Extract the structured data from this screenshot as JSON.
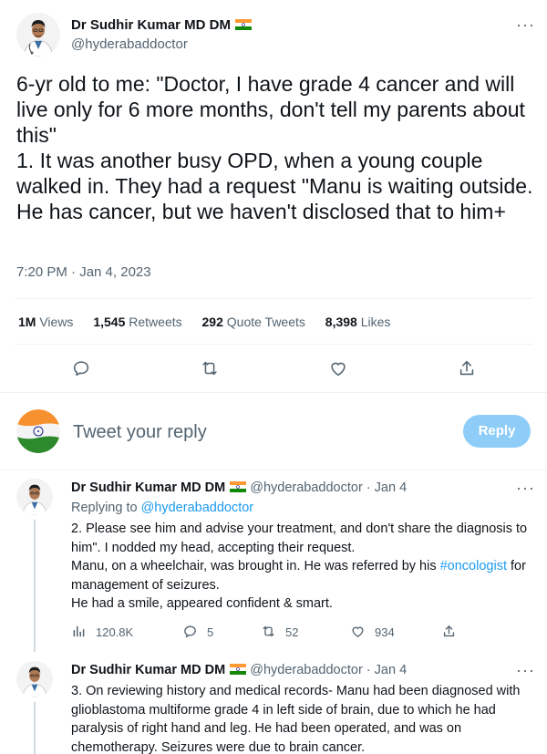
{
  "main_tweet": {
    "author_name": "Dr Sudhir Kumar MD DM",
    "author_handle": "@hyderabaddoctor",
    "text": "6-yr old to me: \"Doctor, I have grade 4 cancer and will live only for 6 more months, don't tell my parents about this\"\n1. It was another busy OPD, when a young couple walked in. They had a request \"Manu is waiting outside. He has cancer, but we haven't disclosed that to him+",
    "timestamp": "7:20 PM · Jan 4, 2023",
    "stats": {
      "views_num": "1M",
      "views_label": "Views",
      "retweets_num": "1,545",
      "retweets_label": "Retweets",
      "quotes_num": "292",
      "quotes_label": "Quote Tweets",
      "likes_num": "8,398",
      "likes_label": "Likes"
    },
    "icons": [
      "reply-icon",
      "retweet-icon",
      "like-icon",
      "share-icon"
    ]
  },
  "reply_box": {
    "placeholder": "Tweet your reply",
    "button_label": "Reply"
  },
  "replies": [
    {
      "author_name": "Dr Sudhir Kumar MD DM",
      "meta": "@hyderabaddoctor · Jan 4",
      "replying_prefix": "Replying to",
      "replying_to": "@hyderabaddoctor",
      "text_1": "2. Please see him and advise your treatment, and don't share the diagnosis to him\". I nodded my head, accepting their request.",
      "text_2_before": "Manu, on a wheelchair, was brought in. He was referred by his",
      "text_2_link": "#oncologist",
      "text_2_after": "for management of seizures.",
      "text_3": "He had a smile, appeared confident & smart.",
      "views": "120.8K",
      "replies": "5",
      "retweets": "52",
      "likes": "934"
    },
    {
      "author_name": "Dr Sudhir Kumar MD DM",
      "meta": "@hyderabaddoctor · Jan 4",
      "text": "3. On reviewing history and medical records- Manu had been diagnosed with glioblastoma multiforme grade 4 in left side of brain, due to which he had paralysis of right hand and leg. He had been operated, and was on chemotherapy. Seizures were due to brain cancer."
    }
  ],
  "colors": {
    "accent": "#1d9bf0",
    "reply_button": "#8ecdf8",
    "secondary_text": "#536471",
    "divider": "#eff3f4"
  }
}
